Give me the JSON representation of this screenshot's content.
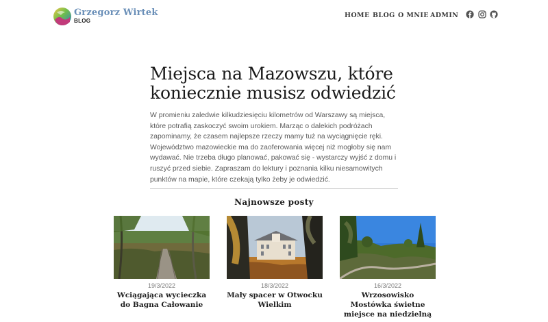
{
  "header": {
    "brand_name": "Grzegorz Wirtek",
    "brand_sub": "BLOG",
    "nav": [
      {
        "label": "HOME"
      },
      {
        "label": "BLOG"
      },
      {
        "label": "O MNIE"
      },
      {
        "label": "ADMIN"
      }
    ],
    "social": [
      "facebook-icon",
      "instagram-icon",
      "github-icon"
    ]
  },
  "article": {
    "title": "Miejsca na Mazowszu, które koniecznie musisz odwiedzić",
    "intro": "W promieniu zaledwie kilkudziesięciu kilometrów od Warszawy są miejsca, które potrafią zaskoczyć swoim urokiem. Marząc o dalekich podróżach zapominamy, że czasem najlepsze rzeczy mamy tuż na wyciągnięcie ręki. Województwo mazowieckie ma do zaoferowania więcej niż mogłoby się nam wydawać. Nie trzeba długo planować, pakować się - wystarczy wyjść z domu i ruszyć przed siebie. Zapraszam do lektury i poznania kilku niesamowitych punktów na mapie, które czekają tylko żeby je odwiedzić."
  },
  "latest": {
    "heading": "Najnowsze posty",
    "posts": [
      {
        "date": "19/3/2022",
        "title": "Wciągająca wycieczka do Bagna Całowanie"
      },
      {
        "date": "18/3/2022",
        "title": "Mały spacer w Otwocku Wielkim"
      },
      {
        "date": "16/3/2022",
        "title": "Wrzosowisko Mostówka świetne miejsce na niedzielną wyprawę"
      }
    ]
  }
}
